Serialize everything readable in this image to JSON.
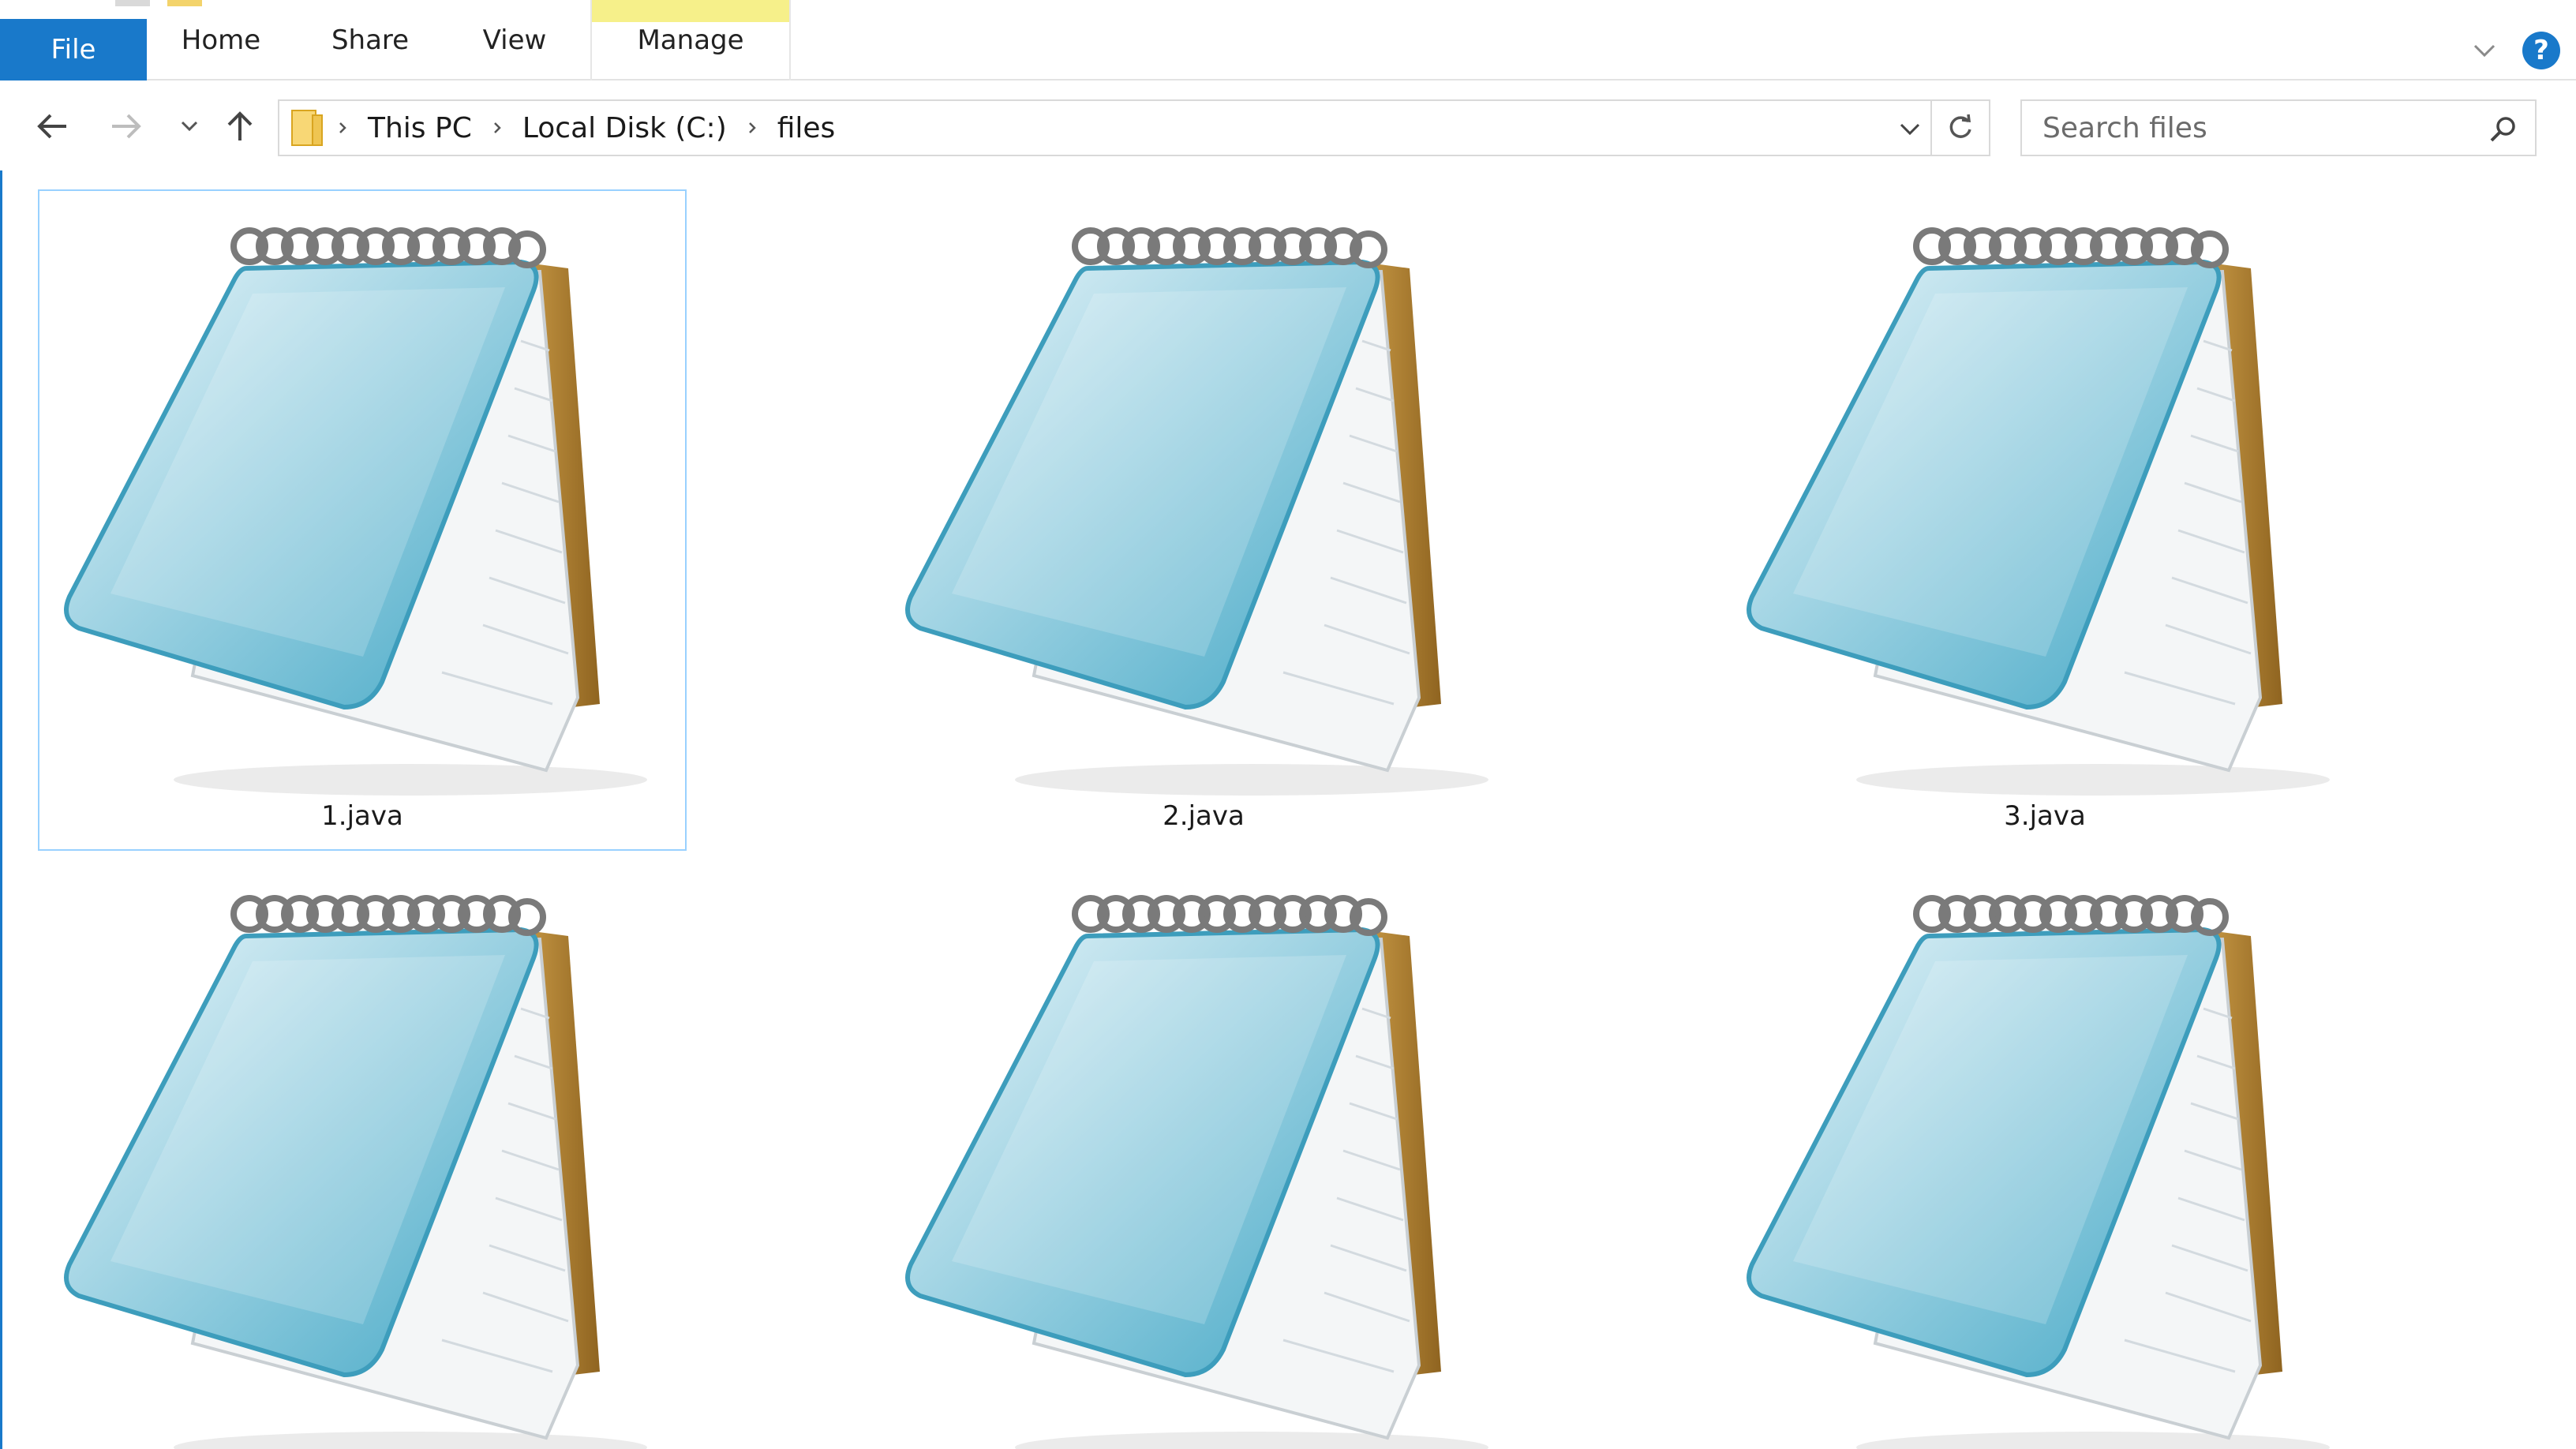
{
  "ribbon": {
    "tabs": [
      {
        "label": "File"
      },
      {
        "label": "Home"
      },
      {
        "label": "Share"
      },
      {
        "label": "View"
      },
      {
        "label": "Manage"
      }
    ],
    "help_label": "?"
  },
  "address": {
    "crumbs": [
      "This PC",
      "Local Disk (C:)",
      "files"
    ]
  },
  "search": {
    "placeholder": "Search files"
  },
  "files": [
    {
      "name": "1.java",
      "icon": "notepad-icon",
      "selected": true
    },
    {
      "name": "2.java",
      "icon": "notepad-icon",
      "selected": false
    },
    {
      "name": "3.java",
      "icon": "notepad-icon",
      "selected": false
    },
    {
      "name": "",
      "icon": "notepad-icon",
      "selected": false
    },
    {
      "name": "",
      "icon": "notepad-icon",
      "selected": false
    },
    {
      "name": "",
      "icon": "notepad-icon",
      "selected": false
    }
  ],
  "colors": {
    "accent": "#1979ca",
    "selection_border": "#99d1ff",
    "manage_bar": "#f6f08a"
  }
}
